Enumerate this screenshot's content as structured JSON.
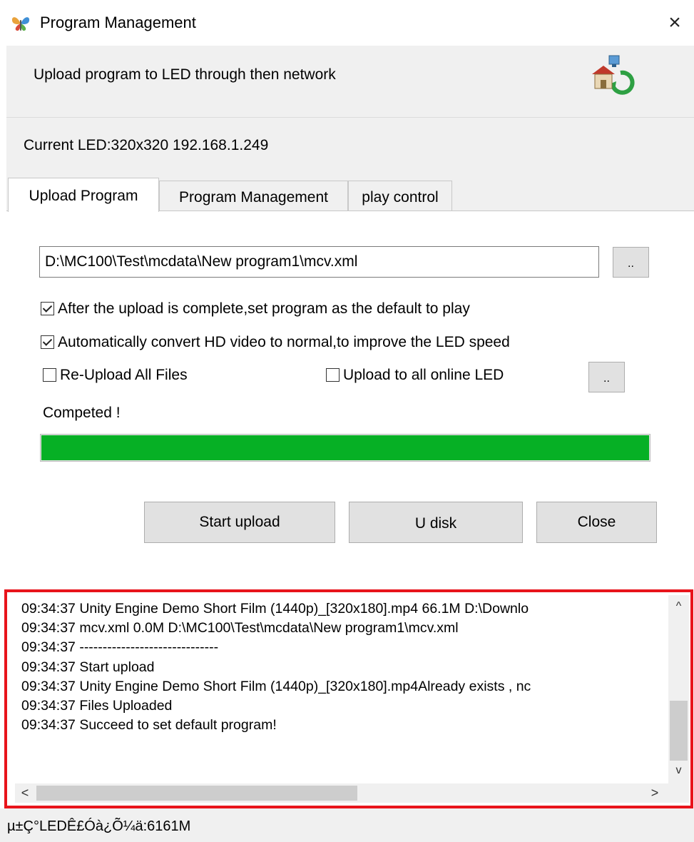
{
  "window": {
    "title": "Program Management",
    "icon": "butterfly-app-icon",
    "close_label": "×"
  },
  "header": {
    "description": "Upload program to LED  through then network",
    "icon": "network-house-icon"
  },
  "current_led": "Current LED:320x320 192.168.1.249",
  "tabs": [
    {
      "label": "Upload Program",
      "active": true
    },
    {
      "label": "Program Management",
      "active": false
    },
    {
      "label": "play control",
      "active": false
    }
  ],
  "upload": {
    "path_value": "D:\\MC100\\Test\\mcdata\\New program1\\mcv.xml",
    "browse_label": "..",
    "options": {
      "set_default": {
        "label": "After the upload is complete,set program as the default to play",
        "checked": true
      },
      "convert_hd": {
        "label": "Automatically convert HD video to normal,to improve the LED speed",
        "checked": true
      },
      "reupload_all": {
        "label": "Re-Upload All Files",
        "checked": false
      },
      "all_online_led": {
        "label": "Upload to all online LED",
        "checked": false
      }
    },
    "led_select_label": "..",
    "status": "Competed !",
    "progress_percent": 100,
    "progress_color": "#06b025",
    "buttons": {
      "start": "Start upload",
      "udisk": "U disk",
      "close": "Close"
    }
  },
  "log": {
    "highlight_color": "#e8141b",
    "lines": [
      "09:34:37  Unity Engine Demo Short Film (1440p)_[320x180].mp4 66.1M D:\\Downlo",
      "09:34:37  mcv.xml 0.0M D:\\MC100\\Test\\mcdata\\New program1\\mcv.xml",
      "09:34:37  ------------------------------",
      "09:34:37  Start upload",
      "09:34:37  Unity Engine Demo Short Film (1440p)_[320x180].mp4Already exists , nc",
      "09:34:37  Files Uploaded",
      "09:34:37  Succeed to set default program!"
    ],
    "scroll_up": "^",
    "scroll_down": "v",
    "scroll_left": "<",
    "scroll_right": ">"
  },
  "status_bar": "µ±Ç°LEDÊ£Óà¿Õ¼ä:6161M"
}
